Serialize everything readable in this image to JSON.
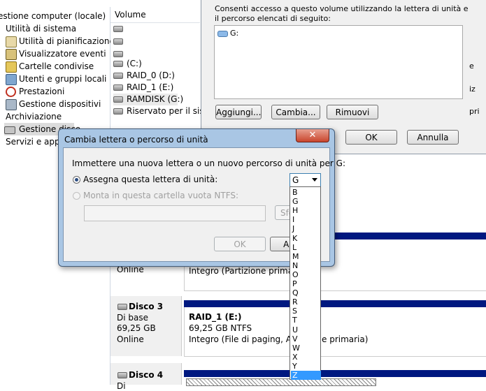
{
  "tree": {
    "items": [
      {
        "label": "estione computer (locale)",
        "icon": "computer-management-icon"
      },
      {
        "label": "Utilità di sistema",
        "icon": ""
      },
      {
        "label": "Utilità di pianificazione",
        "icon": "clock-icon"
      },
      {
        "label": "Visualizzatore eventi",
        "icon": "event-viewer-icon"
      },
      {
        "label": "Cartelle condivise",
        "icon": "shared-folder-icon"
      },
      {
        "label": "Utenti e gruppi locali",
        "icon": "users-icon"
      },
      {
        "label": "Prestazioni",
        "icon": "performance-icon"
      },
      {
        "label": "Gestione dispositivi",
        "icon": "device-manager-icon"
      },
      {
        "label": "Archiviazione",
        "icon": ""
      },
      {
        "label": "Gestione disco",
        "icon": "disk-management-icon"
      },
      {
        "label": "Servizi e applic",
        "icon": "services-icon"
      }
    ]
  },
  "volume_list": {
    "header": "Volume",
    "rows": [
      "",
      "",
      "",
      "(C:)",
      "RAID_0 (D:)",
      "RAID_1 (E:)",
      "RAMDISK (G:)",
      "Riservato per il sistem"
    ]
  },
  "props_dialog": {
    "description": "Consenti accesso a questo volume utilizzando la lettera di unità e il percorso elencati di seguito:",
    "path_item": "G:",
    "add_label": "Aggiungi...",
    "change_label": "Cambia...",
    "remove_label": "Rimuovi",
    "ok_label": "OK",
    "cancel_label": "Annulla",
    "right_fragments": [
      "e",
      "iz",
      "pri"
    ]
  },
  "modal": {
    "title": "Cambia lettera o percorso di unità",
    "close_glyph": "✕",
    "instruction": "Immettere una nuova lettera o un nuovo percorso di unità per G:",
    "assign_label": "Assegna questa lettera di unità:",
    "mount_label": "Monta in questa cartella vuota NTFS:",
    "browse_label": "Sfo",
    "ok_label": "OK",
    "cancel_label": "An",
    "selected_letter": "G",
    "letters": [
      "B",
      "G",
      "H",
      "I",
      "J",
      "K",
      "L",
      "M",
      "N",
      "O",
      "P",
      "Q",
      "R",
      "S",
      "T",
      "U",
      "V",
      "W",
      "X",
      "Y",
      "Z"
    ],
    "highlighted": "Z"
  },
  "disks": {
    "online_top": "Online",
    "status_top": "Integro (Partizione primaria",
    "disk3": {
      "name": "Disco 3",
      "type": "Di base",
      "size": "69,25 GB",
      "status": "Online"
    },
    "disk3_volume": {
      "name": "RAID_1  (E:)",
      "fs": "69,25 GB NTFS",
      "status": "Integro (File di paging, Attiv",
      "status_tail": "e primaria)"
    },
    "disk4": {
      "name": "Disco 4",
      "type": "Di"
    }
  }
}
